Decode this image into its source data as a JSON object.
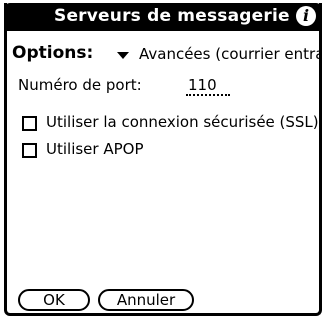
{
  "window": {
    "title": "Serveurs de messagerie",
    "info_icon": "info-icon"
  },
  "options": {
    "label": "Options:",
    "selected": "Avancées (courrier entrant)"
  },
  "port": {
    "label": "Numéro de port:",
    "value": "110"
  },
  "checkboxes": [
    {
      "label": "Utiliser la connexion sécurisée (SSL)",
      "checked": false
    },
    {
      "label": "Utiliser APOP",
      "checked": false
    }
  ],
  "buttons": {
    "ok": "OK",
    "cancel": "Annuler"
  }
}
